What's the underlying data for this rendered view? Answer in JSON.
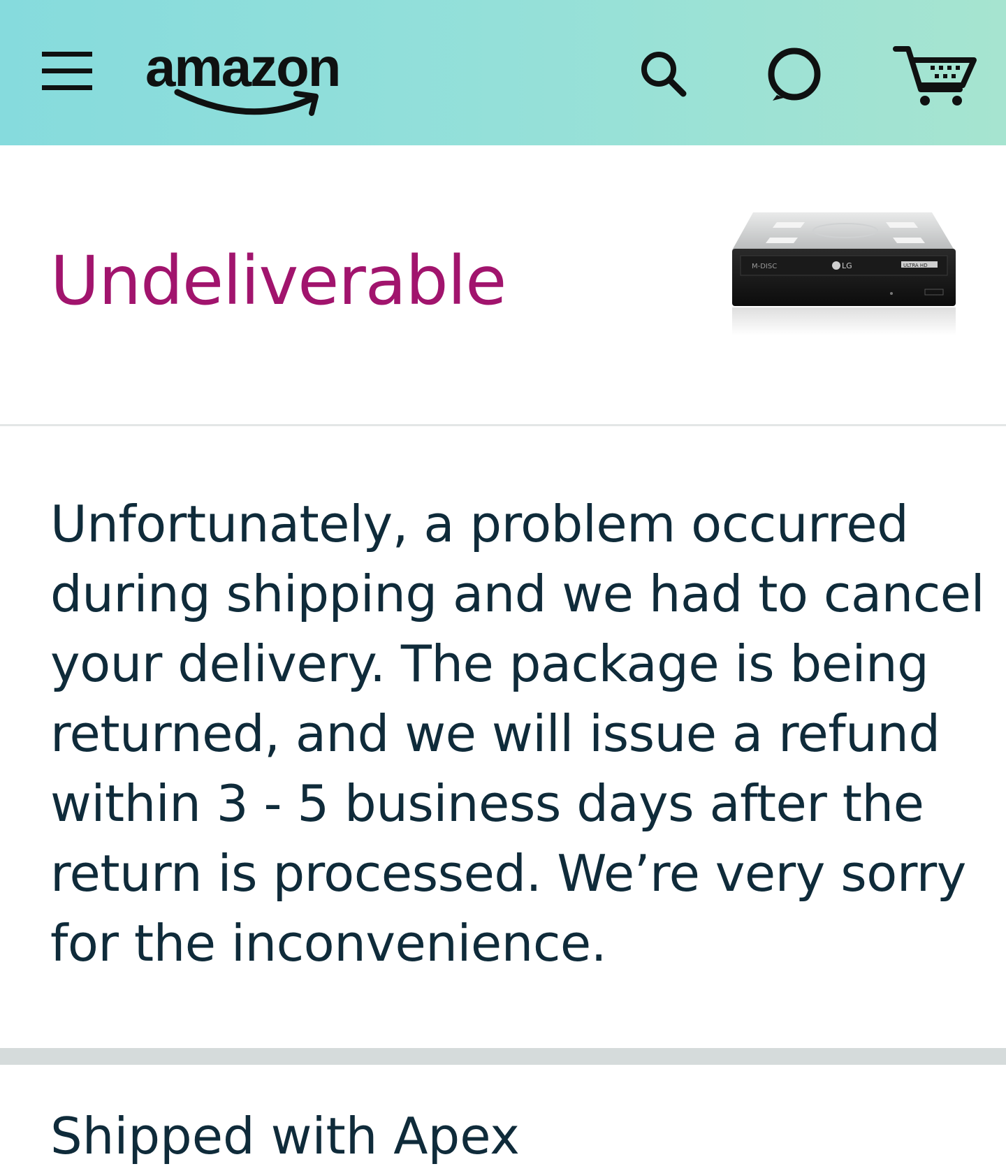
{
  "header": {
    "logo_text": "amazon",
    "background_colors": [
      "#86dbdd",
      "#a6e4d0"
    ],
    "icons": {
      "menu": "hamburger-menu-icon",
      "search": "search-icon",
      "alexa": "alexa-ring-icon",
      "cart": "cart-icon"
    }
  },
  "status": {
    "title": "Undeliverable",
    "title_color": "#a1146d",
    "product_image": {
      "alt": "LG internal optical disc drive",
      "labels": [
        "M-DISC",
        "LG",
        "ULTRA HD"
      ]
    }
  },
  "message": {
    "lines": [
      "Unfortunately, a problem occurred",
      "during shipping and we had to cancel",
      "your delivery. The package is being",
      "returned, and we will issue a refund",
      "within 3 - 5 business days after the",
      "return is processed. We’re very sorry",
      "for the inconvenience."
    ]
  },
  "shipping": {
    "heading": "Shipped with Apex"
  }
}
